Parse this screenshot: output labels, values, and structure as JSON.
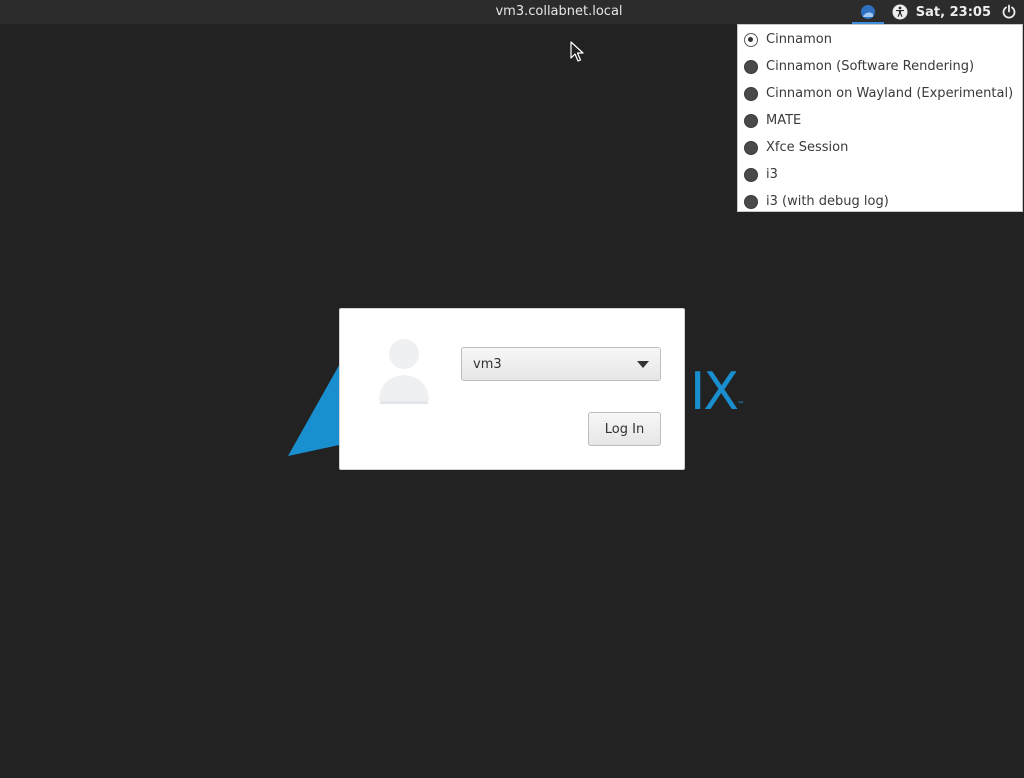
{
  "topbar": {
    "hostname": "vm3.collabnet.local",
    "clock": "Sat, 23:05",
    "accent_color": "#3f8ede"
  },
  "session_menu": {
    "items": [
      {
        "label": "Cinnamon",
        "selected": true
      },
      {
        "label": "Cinnamon (Software Rendering)",
        "selected": false
      },
      {
        "label": "Cinnamon on Wayland (Experimental)",
        "selected": false
      },
      {
        "label": "MATE",
        "selected": false
      },
      {
        "label": "Xfce Session",
        "selected": false
      },
      {
        "label": "i3",
        "selected": false
      },
      {
        "label": "i3 (with debug log)",
        "selected": false
      }
    ]
  },
  "background_logo": {
    "text": "IX",
    "trademark": "™",
    "color": "#1a8fcf"
  },
  "login": {
    "user_value": "vm3",
    "login_button_label": "Log In"
  },
  "icons": {
    "session": "session-icon",
    "accessibility": "accessibility-icon",
    "power": "power-icon",
    "avatar": "user-avatar-icon",
    "dropdown": "chevron-down-icon",
    "cursor": "mouse-pointer-icon"
  }
}
